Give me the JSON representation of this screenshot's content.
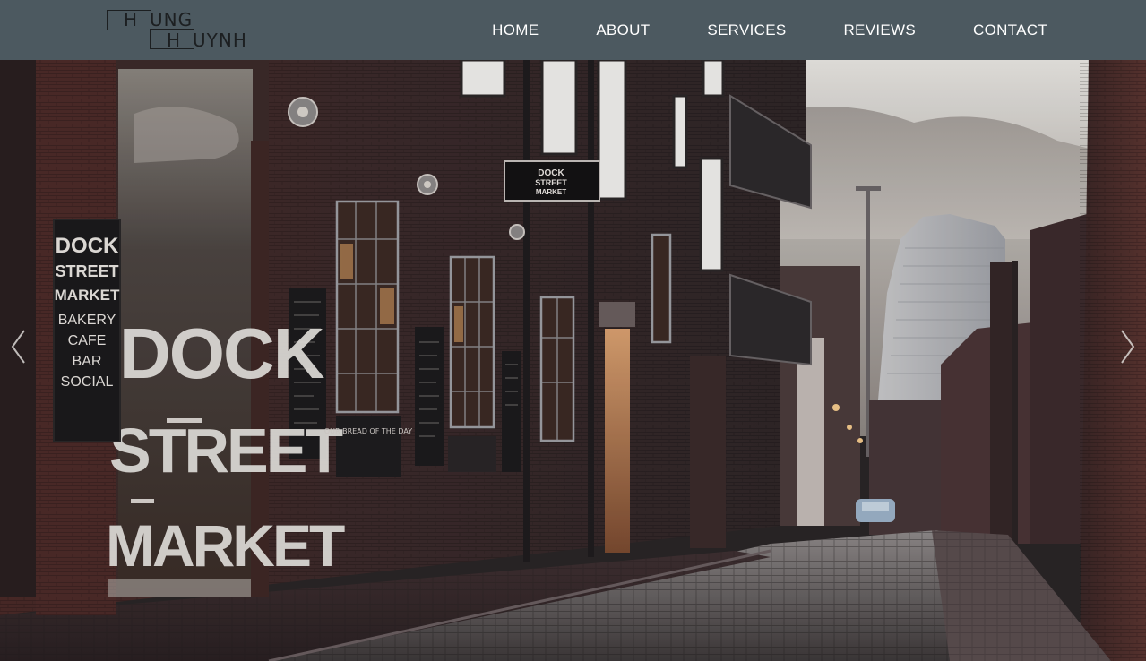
{
  "brand": {
    "first_initial": "H",
    "first_rest": "UNG",
    "last_initial": "H",
    "last_rest": "UYNH"
  },
  "nav": {
    "items": [
      {
        "label": "HOME"
      },
      {
        "label": "ABOUT"
      },
      {
        "label": "SERVICES"
      },
      {
        "label": "REVIEWS"
      },
      {
        "label": "CONTACT"
      }
    ]
  },
  "hero": {
    "sign_main": [
      "DOCK",
      "STREET",
      "MARKET"
    ],
    "sign_board": [
      "DOCK",
      "STREET",
      "MARKET",
      "BAKERY",
      "CAFE",
      "BAR",
      "SOCIAL"
    ],
    "hanging_sign": [
      "DOCK",
      "STREET",
      "MARKET"
    ],
    "chalkboard_caption": "OUR BREAD OF THE DAY"
  },
  "carousel": {
    "prev_icon": "chevron-left-icon",
    "next_icon": "chevron-right-icon"
  },
  "colors": {
    "navbar_bg": "#4c5960",
    "nav_text": "#ffffff",
    "logo_ink": "#1c1f21"
  }
}
